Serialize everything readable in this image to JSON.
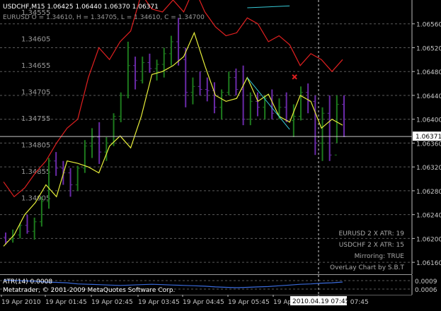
{
  "chart_data": {
    "type": "candlestick-overlay",
    "header": {
      "line1": "USDCHF,M15  1.06425 1.06440 1.06370 1.06371",
      "line2": "EURUSD O = 1.34610, H = 1.34705, L = 1.34610, C = 1.34700"
    },
    "right_axis_ticks": [
      "1.06560",
      "1.06520",
      "1.06480",
      "1.06440",
      "1.06400",
      "1.06360",
      "1.06320",
      "1.06280",
      "1.06240",
      "1.06200",
      "1.06160"
    ],
    "current_price": "1.06371",
    "overlay_ticks": [
      "1.34555",
      "1.34605",
      "1.34655",
      "1.34705",
      "1.34755",
      "1.34805",
      "1.34855",
      "1.34905"
    ],
    "info_box": [
      "EURUSD 2 X ATR: 19",
      "USDCHF 2 X ATR: 15",
      "Mirroring: TRUE",
      "OverLay Chart by S.B.T"
    ],
    "indicator": {
      "label": "ATR(14) 0.0008",
      "copyright": "Metatrader, © 2001-2009 MetaQuotes Software Corp.",
      "ticks": [
        "0.0009",
        "0.0006"
      ]
    },
    "time_ticks": [
      "19 Apr 2010",
      "19 Apr 01:45",
      "19 Apr 02:45",
      "19 Apr 03:45",
      "19 Apr 04:45",
      "19 Apr 05:45",
      "19 Apr 06:45",
      "19 Apr 07:45"
    ],
    "crosshair_time": "2010.04.19 07:45",
    "y_range": [
      1.0614,
      1.066
    ],
    "candles": [
      {
        "o": 1.06202,
        "h": 1.0621,
        "l": 1.0619,
        "c": 1.06195
      },
      {
        "o": 1.06198,
        "h": 1.06215,
        "l": 1.06193,
        "c": 1.06206
      },
      {
        "o": 1.06206,
        "h": 1.06226,
        "l": 1.062,
        "c": 1.06222
      },
      {
        "o": 1.06222,
        "h": 1.0624,
        "l": 1.06208,
        "c": 1.06212
      },
      {
        "o": 1.06212,
        "h": 1.06235,
        "l": 1.06198,
        "c": 1.06228
      },
      {
        "o": 1.06228,
        "h": 1.0627,
        "l": 1.0622,
        "c": 1.06262
      },
      {
        "o": 1.06262,
        "h": 1.06335,
        "l": 1.0625,
        "c": 1.0633
      },
      {
        "o": 1.0633,
        "h": 1.06345,
        "l": 1.06305,
        "c": 1.06318
      },
      {
        "o": 1.06318,
        "h": 1.0633,
        "l": 1.0629,
        "c": 1.0631
      },
      {
        "o": 1.0631,
        "h": 1.06318,
        "l": 1.0627,
        "c": 1.0629
      },
      {
        "o": 1.0629,
        "h": 1.06322,
        "l": 1.0628,
        "c": 1.06318
      },
      {
        "o": 1.06318,
        "h": 1.06365,
        "l": 1.0631,
        "c": 1.06355
      },
      {
        "o": 1.06355,
        "h": 1.06385,
        "l": 1.06335,
        "c": 1.0637
      },
      {
        "o": 1.0637,
        "h": 1.06395,
        "l": 1.06325,
        "c": 1.06345
      },
      {
        "o": 1.06345,
        "h": 1.0637,
        "l": 1.0633,
        "c": 1.0636
      },
      {
        "o": 1.0636,
        "h": 1.0641,
        "l": 1.06355,
        "c": 1.06405
      },
      {
        "o": 1.06405,
        "h": 1.06445,
        "l": 1.06395,
        "c": 1.0644
      },
      {
        "o": 1.0644,
        "h": 1.0653,
        "l": 1.06435,
        "c": 1.0649
      },
      {
        "o": 1.0649,
        "h": 1.06505,
        "l": 1.0645,
        "c": 1.06465
      },
      {
        "o": 1.06465,
        "h": 1.06505,
        "l": 1.0646,
        "c": 1.06495
      },
      {
        "o": 1.06495,
        "h": 1.0651,
        "l": 1.06478,
        "c": 1.06485
      },
      {
        "o": 1.06485,
        "h": 1.065,
        "l": 1.06465,
        "c": 1.06492
      },
      {
        "o": 1.06492,
        "h": 1.0652,
        "l": 1.0647,
        "c": 1.0651
      },
      {
        "o": 1.0651,
        "h": 1.0654,
        "l": 1.0649,
        "c": 1.0653
      },
      {
        "o": 1.0653,
        "h": 1.0657,
        "l": 1.0649,
        "c": 1.065
      },
      {
        "o": 1.065,
        "h": 1.0652,
        "l": 1.0642,
        "c": 1.06445
      },
      {
        "o": 1.06445,
        "h": 1.0647,
        "l": 1.06425,
        "c": 1.06455
      },
      {
        "o": 1.06455,
        "h": 1.0648,
        "l": 1.0644,
        "c": 1.0645
      },
      {
        "o": 1.0645,
        "h": 1.0647,
        "l": 1.0643,
        "c": 1.06448
      },
      {
        "o": 1.06448,
        "h": 1.06462,
        "l": 1.0641,
        "c": 1.0642
      },
      {
        "o": 1.0642,
        "h": 1.0645,
        "l": 1.064,
        "c": 1.06445
      },
      {
        "o": 1.06445,
        "h": 1.0648,
        "l": 1.0644,
        "c": 1.0647
      },
      {
        "o": 1.0647,
        "h": 1.06485,
        "l": 1.0644,
        "c": 1.0645
      },
      {
        "o": 1.0645,
        "h": 1.0649,
        "l": 1.0639,
        "c": 1.064
      },
      {
        "o": 1.064,
        "h": 1.06445,
        "l": 1.0639,
        "c": 1.0643
      },
      {
        "o": 1.0643,
        "h": 1.06445,
        "l": 1.06405,
        "c": 1.0642
      },
      {
        "o": 1.0642,
        "h": 1.0644,
        "l": 1.064,
        "c": 1.06435
      },
      {
        "o": 1.06435,
        "h": 1.0645,
        "l": 1.064,
        "c": 1.0641
      },
      {
        "o": 1.0641,
        "h": 1.06435,
        "l": 1.064,
        "c": 1.0642
      },
      {
        "o": 1.0642,
        "h": 1.06445,
        "l": 1.06395,
        "c": 1.06398
      },
      {
        "o": 1.06398,
        "h": 1.06425,
        "l": 1.0637,
        "c": 1.06405
      },
      {
        "o": 1.06405,
        "h": 1.06455,
        "l": 1.06398,
        "c": 1.06445
      },
      {
        "o": 1.06445,
        "h": 1.0646,
        "l": 1.0641,
        "c": 1.0643
      },
      {
        "o": 1.0643,
        "h": 1.0644,
        "l": 1.0634,
        "c": 1.0636
      },
      {
        "o": 1.0636,
        "h": 1.0642,
        "l": 1.0633,
        "c": 1.0641
      },
      {
        "o": 1.0641,
        "h": 1.0644,
        "l": 1.0633,
        "c": 1.0634
      },
      {
        "o": 1.0634,
        "h": 1.0644,
        "l": 1.0636,
        "c": 1.06425
      },
      {
        "o": 1.06425,
        "h": 1.0644,
        "l": 1.0637,
        "c": 1.06371
      }
    ],
    "yellow_line": [
      1.06187,
      1.06206,
      1.0624,
      1.0626,
      1.0629,
      1.0627,
      1.0633,
      1.06326,
      1.0632,
      1.0631,
      1.06355,
      1.06372,
      1.06352,
      1.06405,
      1.06475,
      1.0648,
      1.0649,
      1.06505,
      1.06545,
      1.0649,
      1.0644,
      1.0643,
      1.06435,
      1.0647,
      1.0643,
      1.06442,
      1.06405,
      1.06395,
      1.0644,
      1.0643,
      1.06385,
      1.064,
      1.0639
    ],
    "red_line": [
      1.06295,
      1.0627,
      1.06285,
      1.0631,
      1.0633,
      1.0636,
      1.06385,
      1.064,
      1.0647,
      1.0652,
      1.065,
      1.0653,
      1.06548,
      1.0661,
      1.06585,
      1.0658,
      1.066,
      1.0658,
      1.0662,
      1.0658,
      1.06555,
      1.0654,
      1.06545,
      1.0657,
      1.0656,
      1.0653,
      1.0654,
      1.06525,
      1.0649,
      1.0651,
      1.065,
      1.0648,
      1.065
    ],
    "atr_line": [
      0.00085,
      0.00084,
      0.00083,
      0.00082,
      0.0008,
      0.00079,
      0.00078,
      0.00075,
      0.00074,
      0.00073,
      0.00072,
      0.00071,
      0.00072,
      0.00073,
      0.00074,
      0.00073,
      0.00072,
      0.00071,
      0.0007,
      0.00069,
      0.00067,
      0.00066,
      0.00065,
      0.00066,
      0.00067,
      0.00068,
      0.0007,
      0.00072,
      0.00074,
      0.00075,
      0.00077,
      0.00078,
      0.0008
    ]
  },
  "colors": {
    "grid": "#5a5a5a",
    "bull_candle": "#1d7a1d",
    "bear_candle": "#6a2aa8",
    "yellow_line": "#e8ef3a",
    "red_line": "#e02020",
    "cyan_line": "#36c9d6",
    "marker": "#e02020",
    "text": "#c8c8c8",
    "atr": "#3a6bdc"
  }
}
